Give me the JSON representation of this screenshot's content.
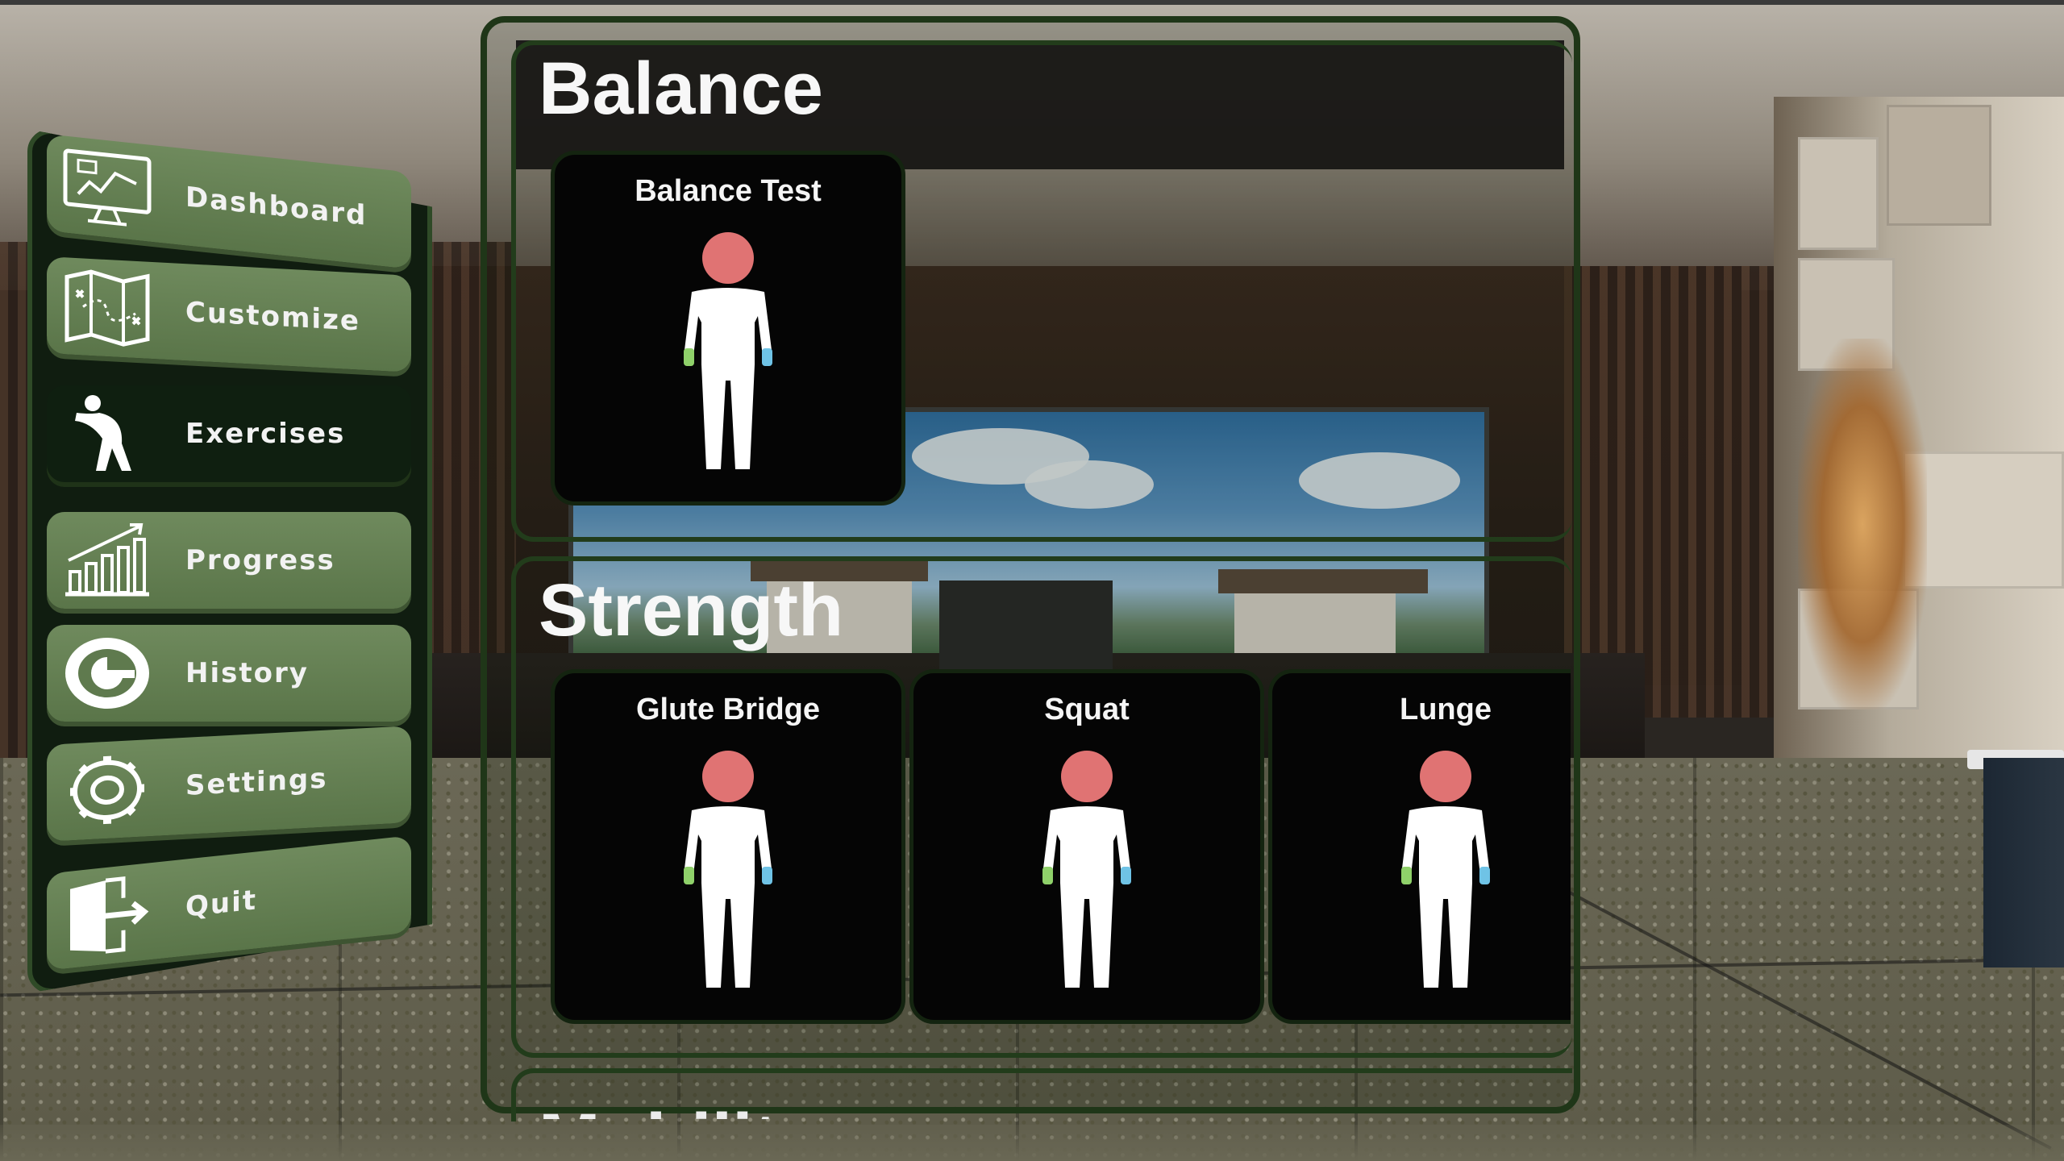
{
  "menu": {
    "items": [
      {
        "label": "Dashboard",
        "icon": "dashboard-icon",
        "active": false
      },
      {
        "label": "Customize",
        "icon": "map-icon",
        "active": false
      },
      {
        "label": "Exercises",
        "icon": "stretching-person-icon",
        "active": true
      },
      {
        "label": "Progress",
        "icon": "bar-chart-icon",
        "active": false
      },
      {
        "label": "History",
        "icon": "history-clock-icon",
        "active": false
      },
      {
        "label": "Settings",
        "icon": "gear-icon",
        "active": false
      },
      {
        "label": "Quit",
        "icon": "exit-door-icon",
        "active": false
      }
    ]
  },
  "sections": [
    {
      "title": "Balance",
      "exercises": [
        {
          "name": "Balance Test"
        }
      ]
    },
    {
      "title": "Strength",
      "exercises": [
        {
          "name": "Glute Bridge"
        },
        {
          "name": "Squat"
        },
        {
          "name": "Lunge"
        }
      ]
    },
    {
      "title": "Mobility",
      "exercises": []
    }
  ],
  "colors": {
    "menu_button": "#6f8a5d",
    "menu_active": "#0f1f10",
    "panel_border": "#1f3618",
    "avatar_head": "#e07373",
    "left_hand": "#8fd16a",
    "right_hand": "#6fc3e6"
  }
}
